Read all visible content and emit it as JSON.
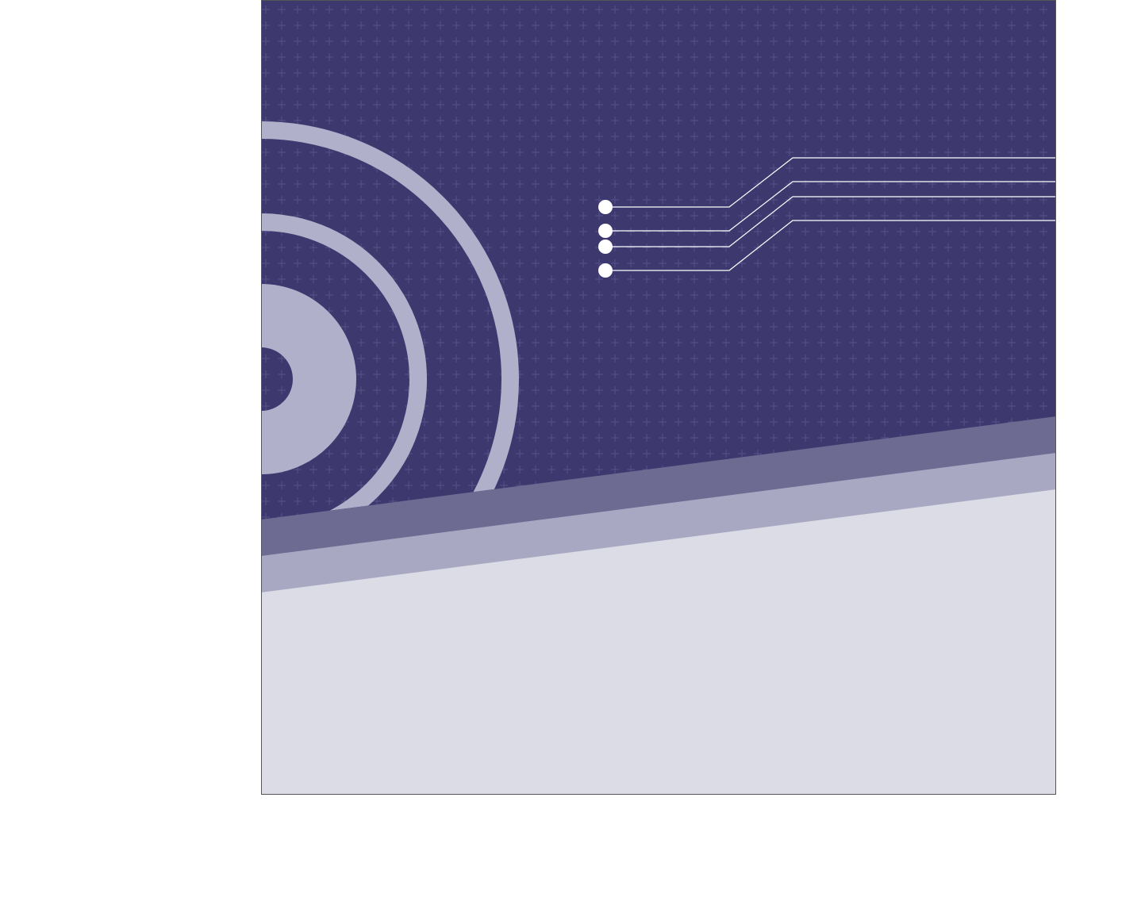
{
  "colors": {
    "page_background": "#ffffff",
    "top_panel": "#3d396e",
    "grid_cross": "#56528a",
    "rings": "#b1b0cb",
    "band_dark": "#6e6b93",
    "band_mid": "#a9a8c2",
    "bottom_panel": "#dcdce6",
    "connector_lines": "#ffffff",
    "frame_border": "#555555"
  },
  "icons": {
    "rings": "concentric-rings-icon",
    "connector_dots": "connector-node-icon"
  },
  "connectors": [
    {
      "name": "connector-1"
    },
    {
      "name": "connector-2"
    },
    {
      "name": "connector-3"
    },
    {
      "name": "connector-4"
    }
  ]
}
